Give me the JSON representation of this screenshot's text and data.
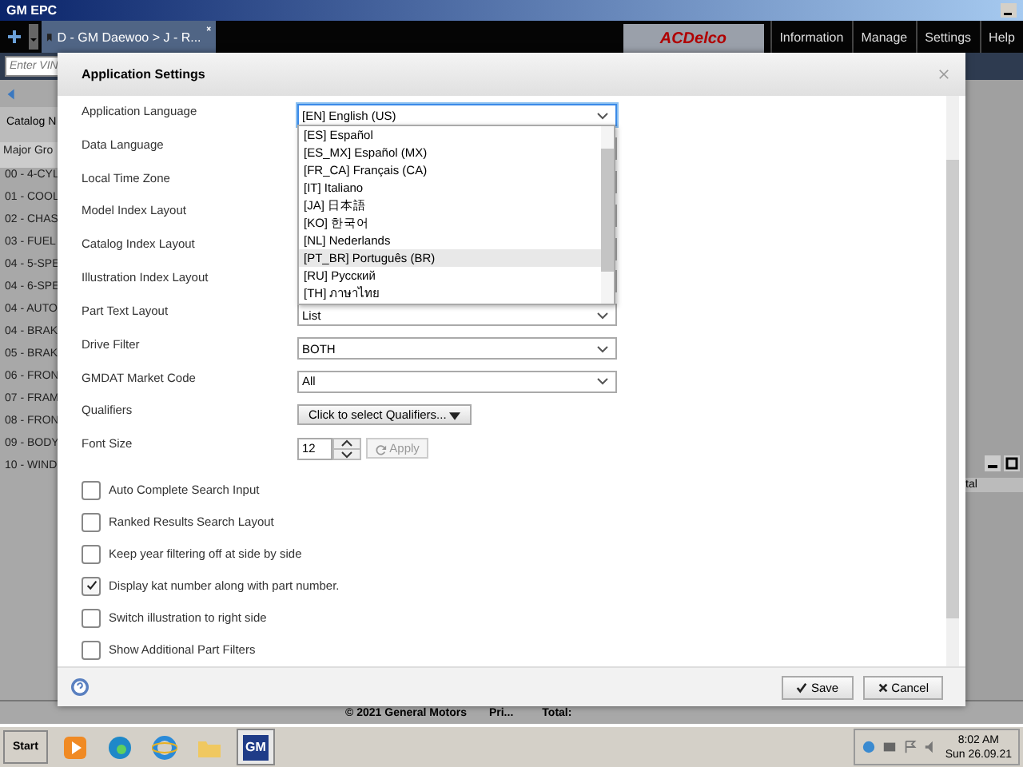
{
  "window": {
    "title": "GM EPC"
  },
  "app_header": {
    "tab": {
      "label": "D - GM Daewoo > J - R...",
      "selected": true
    },
    "logo": "ACDelco",
    "menu": [
      {
        "label": "Information"
      },
      {
        "label": "Manage"
      },
      {
        "label": "Settings"
      },
      {
        "label": "Help"
      }
    ]
  },
  "vin_field": {
    "placeholder": "Enter VIN"
  },
  "background": {
    "catalog_header": "Catalog N",
    "list_header": "Major Gro",
    "groups": [
      "00 - 4-CYL",
      "01 - COOL",
      "02 - CHAS",
      "03 - FUEL",
      "04 - 5-SPE",
      "04 - 6-SPE",
      "04 - AUTO",
      "04 - BRAK",
      "05 - BRAK",
      "06 - FRON",
      "07 - FRAM",
      "08 - FRON",
      "09 - BODY",
      "10 - WIND"
    ],
    "total_header": "tal",
    "total_label": "Total:",
    "footer": [
      "© 2021 General Motors",
      "Pri..."
    ]
  },
  "dialog": {
    "title": "Application Settings",
    "fields": [
      {
        "label": "Application Language",
        "kind": "select",
        "value": "[EN] English (US)",
        "focused": true
      },
      {
        "label": "Data Language",
        "kind": "select",
        "focused": false
      },
      {
        "label": "Local Time Zone",
        "kind": "select",
        "focused": false
      },
      {
        "label": "Model Index Layout",
        "kind": "select",
        "focused": false
      },
      {
        "label": "Catalog Index Layout",
        "kind": "select",
        "focused": false
      },
      {
        "label": "Illustration Index Layout",
        "kind": "select",
        "focused": false
      },
      {
        "label": "Part Text Layout",
        "kind": "select",
        "value": "List",
        "focused": false
      },
      {
        "label": "Drive Filter",
        "kind": "select",
        "value": "BOTH",
        "focused": false
      },
      {
        "label": "GMDAT Market Code",
        "kind": "select",
        "value": "All",
        "focused": false
      },
      {
        "label": "Qualifiers",
        "kind": "menu_button",
        "value": "Click to select Qualifiers...",
        "focused": false
      },
      {
        "label": "Font Size",
        "kind": "spinner",
        "value": "12",
        "action": "Apply",
        "focused": false
      }
    ],
    "language_options": [
      {
        "label": "[ES] Español",
        "highlighted": false
      },
      {
        "label": "[ES_MX] Español (MX)",
        "highlighted": false
      },
      {
        "label": "[FR_CA] Français (CA)",
        "highlighted": false
      },
      {
        "label": "[IT] Italiano",
        "highlighted": false
      },
      {
        "label": "[JA] 日本語",
        "highlighted": false
      },
      {
        "label": "[KO] 한국어",
        "highlighted": false
      },
      {
        "label": "[NL] Nederlands",
        "highlighted": false
      },
      {
        "label": "[PT_BR] Português (BR)",
        "highlighted": true
      },
      {
        "label": "[RU] Русский",
        "highlighted": false
      },
      {
        "label": "[TH] ภาษาไทย",
        "highlighted": false
      }
    ],
    "checkboxes": [
      {
        "label": "Auto Complete Search Input",
        "checked": false
      },
      {
        "label": "Ranked Results Search Layout",
        "checked": false
      },
      {
        "label": "Keep year filtering off at side by side",
        "checked": false
      },
      {
        "label": "Display kat number along with part number.",
        "checked": true
      },
      {
        "label": "Switch illustration to right side",
        "checked": false
      },
      {
        "label": "Show Additional Part Filters",
        "checked": false
      }
    ],
    "buttons": [
      {
        "label": "Save",
        "kind": "save"
      },
      {
        "label": "Cancel",
        "kind": "cancel"
      }
    ]
  },
  "taskbar": {
    "start": "Start",
    "apps": [
      {
        "kind": "media",
        "selected": false
      },
      {
        "kind": "edge",
        "selected": false
      },
      {
        "kind": "ie",
        "selected": false
      },
      {
        "kind": "folder",
        "selected": false
      },
      {
        "kind": "gm",
        "label": "GM",
        "selected": true
      }
    ],
    "clock": {
      "time": "8:02 AM",
      "date": "Sun 26.09.21"
    }
  }
}
